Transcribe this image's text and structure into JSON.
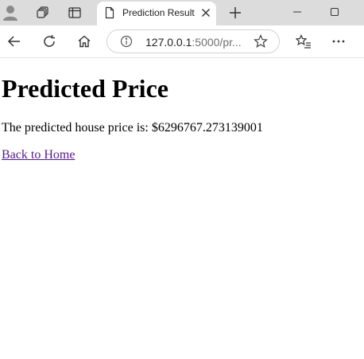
{
  "tab": {
    "title": "Prediction Result"
  },
  "address_bar": {
    "host": "127.0.0.1",
    "rest": ":5000/pr..."
  },
  "page": {
    "heading": "Predicted Price",
    "result_label": "The predicted house price is: $",
    "predicted_price": "6296767.273139001",
    "back_link": "Back to Home"
  },
  "icons": {
    "profile": "profile-avatar-icon",
    "workspaces": "workspaces-icon",
    "tab_actions": "vertical-tabs-icon",
    "page": "page-icon",
    "close": "close-icon",
    "new_tab": "plus-icon",
    "minimize": "minimize-icon",
    "maximize": "maximize-icon",
    "back": "back-arrow-icon",
    "refresh": "refresh-icon",
    "home": "home-icon",
    "info": "info-icon",
    "favorite": "star-icon",
    "favorites": "favorites-list-icon",
    "menu": "more-dots-icon"
  },
  "colors": {
    "tabstrip_bg": "#dcdcdc",
    "visited_link": "#551a8b"
  }
}
